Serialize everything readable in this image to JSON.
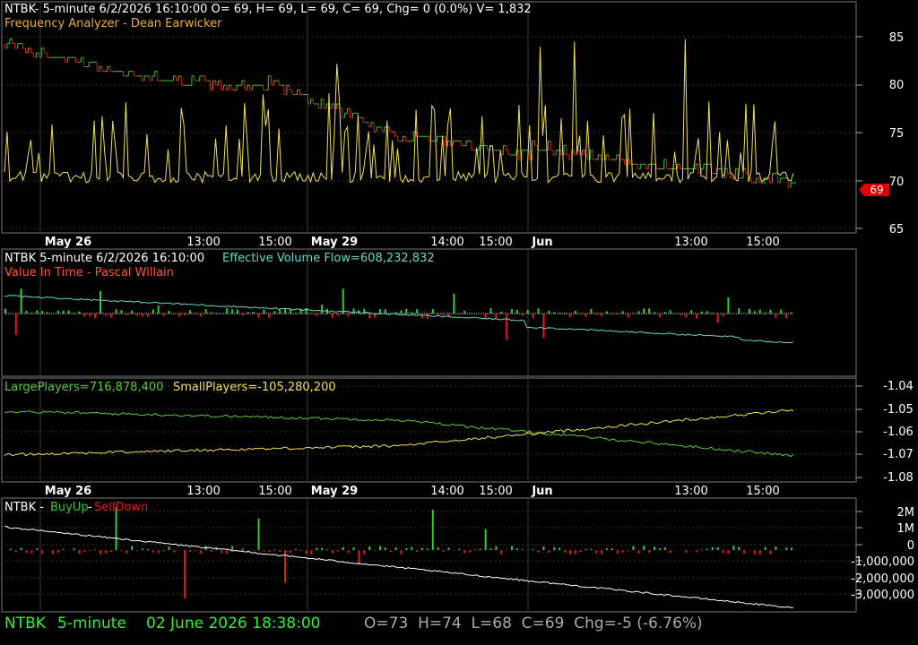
{
  "colors": {
    "background": "#000000",
    "up": "#33cc33",
    "down": "#e51919",
    "yellow": "#f2e050",
    "cyan": "#66d9c8",
    "green_line": "#55cc33",
    "white_line": "#ffffff",
    "grid": "#333333",
    "frame": "#777777",
    "title_orange": "#f0b020",
    "title_red": "#ff5533",
    "footer_green": "#33ee33",
    "footer_gray": "#aaaaaa",
    "last_price_badge": "#e00000"
  },
  "time_axis": {
    "labels": [
      "May 26",
      "13:00",
      "15:00",
      "May 29",
      "14:00",
      "15:00",
      "Jun",
      "13:00",
      "15:00"
    ],
    "bold_labels": [
      "May 26",
      "May 29",
      "Jun"
    ]
  },
  "price_panel": {
    "header": "NTBK- 5-minute 6/2/2026 16:10:00 O= 69, H= 69, L= 69, C= 69, Chg= 0 (0.0%) V= 1,832",
    "indicator": "Frequency Analyzer - Dean Earwicker",
    "y_labels": [
      "85",
      "80",
      "75",
      "70",
      "65"
    ],
    "last_price": "69",
    "chart_data": {
      "type": "line",
      "ylim": [
        63.5,
        88.5
      ],
      "price_steps": [
        {
          "segment": "May 26",
          "start": 84,
          "end": 80.5,
          "end_color": "down"
        },
        {
          "segment": "May 26 PM",
          "start": 80.5,
          "end": 79,
          "end_color": "down"
        },
        {
          "segment": "May 29",
          "start": 80,
          "end": 74,
          "end_color": "down"
        },
        {
          "segment": "May 29 PM",
          "start": 74,
          "end": 72,
          "end_color": "down"
        },
        {
          "segment": "Jun",
          "start": 73,
          "end": 70.5,
          "end_color": "down"
        },
        {
          "segment": "Jun PM",
          "start": 71,
          "end": 69,
          "end_color": "down"
        }
      ],
      "frequency_baseline": 69,
      "frequency_peak_max": 85
    }
  },
  "flow_panel": {
    "header_prefix": "NTBK 5-minute  6/2/2026 16:10:00",
    "indicator_name": "Effective Volume Flow=608,232,832",
    "sub_indicator": "Value In Time - Pascal Willain",
    "chart_data": {
      "type": "line",
      "series": [
        {
          "name": "Effective Volume Flow",
          "start": 1.0,
          "end": 0.3
        }
      ],
      "histogram": "up/down bars around zero line"
    }
  },
  "players_panel": {
    "large_label": "LargePlayers=716,878,400",
    "small_label": "SmallPlayers=-105,280,200",
    "y_labels": [
      "-1.04",
      "-1.05",
      "-1.06",
      "-1.07",
      "-1.08"
    ],
    "chart_data": {
      "type": "line",
      "ylim": [
        -1.08,
        -1.04
      ],
      "series": [
        {
          "name": "LargePlayers",
          "start": -1.051,
          "end": -1.0705
        },
        {
          "name": "SmallPlayers",
          "start": -1.07,
          "end": -1.0505
        }
      ]
    }
  },
  "buyup_panel": {
    "ticker": "NTBK - ",
    "buy_label": "BuyUp",
    "dash": "-",
    "sell_label": "SellDown",
    "y_labels": [
      "2M",
      "1M",
      "0",
      "-1,000,000",
      "-2,000,000",
      "-3,000,000"
    ],
    "chart_data": {
      "type": "line",
      "ylim": [
        -3200000,
        2700000
      ],
      "series": [
        {
          "name": "cumulative",
          "start": 1200000,
          "end": -3000000
        }
      ]
    }
  },
  "footer": {
    "symbol": "NTBK",
    "interval": "5-minute",
    "datetime": "02 June 2026 18:38:00",
    "ohlc": "O=73  H=74  L=68  C=69  Chg=-5 (-6.76%)"
  }
}
